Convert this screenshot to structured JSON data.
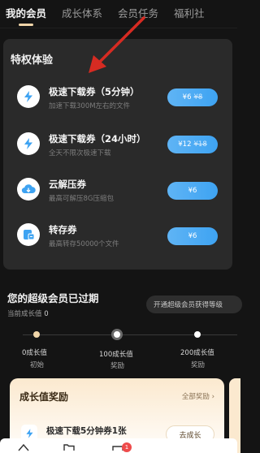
{
  "tabs": [
    {
      "label": "我的会员",
      "active": true
    },
    {
      "label": "成长体系",
      "active": false
    },
    {
      "label": "会员任务",
      "active": false
    },
    {
      "label": "福利社",
      "active": false
    }
  ],
  "privileges": {
    "title": "特权体验",
    "items": [
      {
        "name": "极速下载券（5分钟）",
        "desc": "加速下载300M左右的文件",
        "price": "¥6",
        "old_price": "¥8",
        "icon": "lightning-icon"
      },
      {
        "name": "极速下载券（24小时）",
        "desc": "全天不限次极速下载",
        "price": "¥12",
        "old_price": "¥18",
        "icon": "lightning-icon"
      },
      {
        "name": "云解压券",
        "desc": "最高可解压8G压缩包",
        "price": "¥6",
        "old_price": "",
        "icon": "cloud-download-icon"
      },
      {
        "name": "转存券",
        "desc": "最高转存50000个文件",
        "price": "¥6",
        "old_price": "",
        "icon": "transfer-save-icon"
      }
    ]
  },
  "membership": {
    "expired_title": "您的超级会员已过期",
    "growth_label": "当前成长值",
    "growth_value": "0",
    "open_button": "开通超级会员获得等级"
  },
  "levels": [
    {
      "value": "0成长值",
      "name": "初始"
    },
    {
      "value": "100成长值",
      "name": "奖励"
    },
    {
      "value": "200成长值",
      "name": "奖励"
    }
  ],
  "reward": {
    "title": "成长值奖励",
    "all_link": "全部奖励 ›",
    "item_name": "极速下载5分钟券1张",
    "item_sub": "",
    "button": "去成长"
  },
  "bottom_nav": {
    "badge": "1"
  },
  "colors": {
    "accent_blue": "#45a8f3",
    "annotation_arrow": "#d62b22",
    "tab_indicator": "#f0d5a8"
  }
}
